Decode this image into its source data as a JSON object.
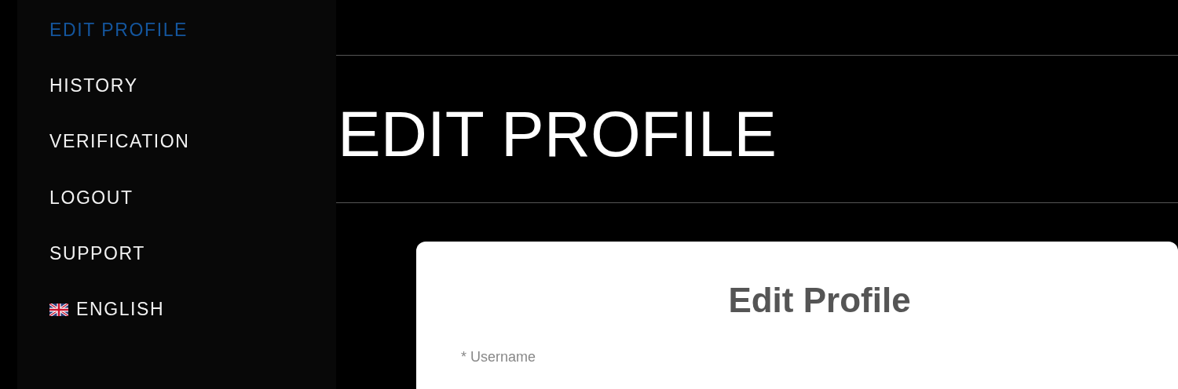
{
  "sidebar": {
    "items": [
      {
        "label": "EDIT PROFILE",
        "selected": true,
        "kind": "link"
      },
      {
        "label": "HISTORY",
        "selected": false,
        "kind": "link"
      },
      {
        "label": "VERIFICATION",
        "selected": false,
        "kind": "link"
      },
      {
        "label": "LOGOUT",
        "selected": false,
        "kind": "link"
      },
      {
        "label": "SUPPORT",
        "selected": false,
        "kind": "link"
      },
      {
        "label": "ENGLISH",
        "selected": false,
        "kind": "language"
      }
    ]
  },
  "page_title": "EDIT PROFILE",
  "card": {
    "title": "Edit Profile",
    "fields": [
      {
        "label": "* Username"
      }
    ]
  }
}
